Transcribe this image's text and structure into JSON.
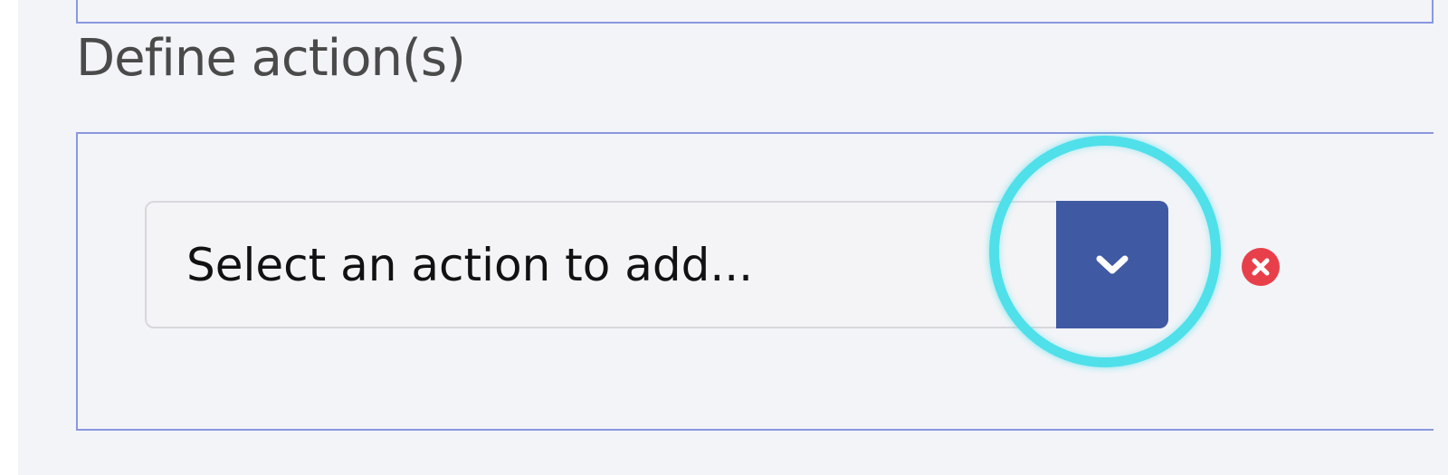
{
  "section": {
    "title": "Define action(s)"
  },
  "action_select": {
    "placeholder": "Select an action to add..."
  },
  "icons": {
    "dropdown": "chevron-down-icon",
    "remove": "close-circle-icon"
  },
  "colors": {
    "panel_border": "#8a98e0",
    "button_bg": "#3f59a3",
    "remove_red": "#e8404a",
    "highlight": "#4fe0ea",
    "page_bg": "#f3f4f8"
  }
}
